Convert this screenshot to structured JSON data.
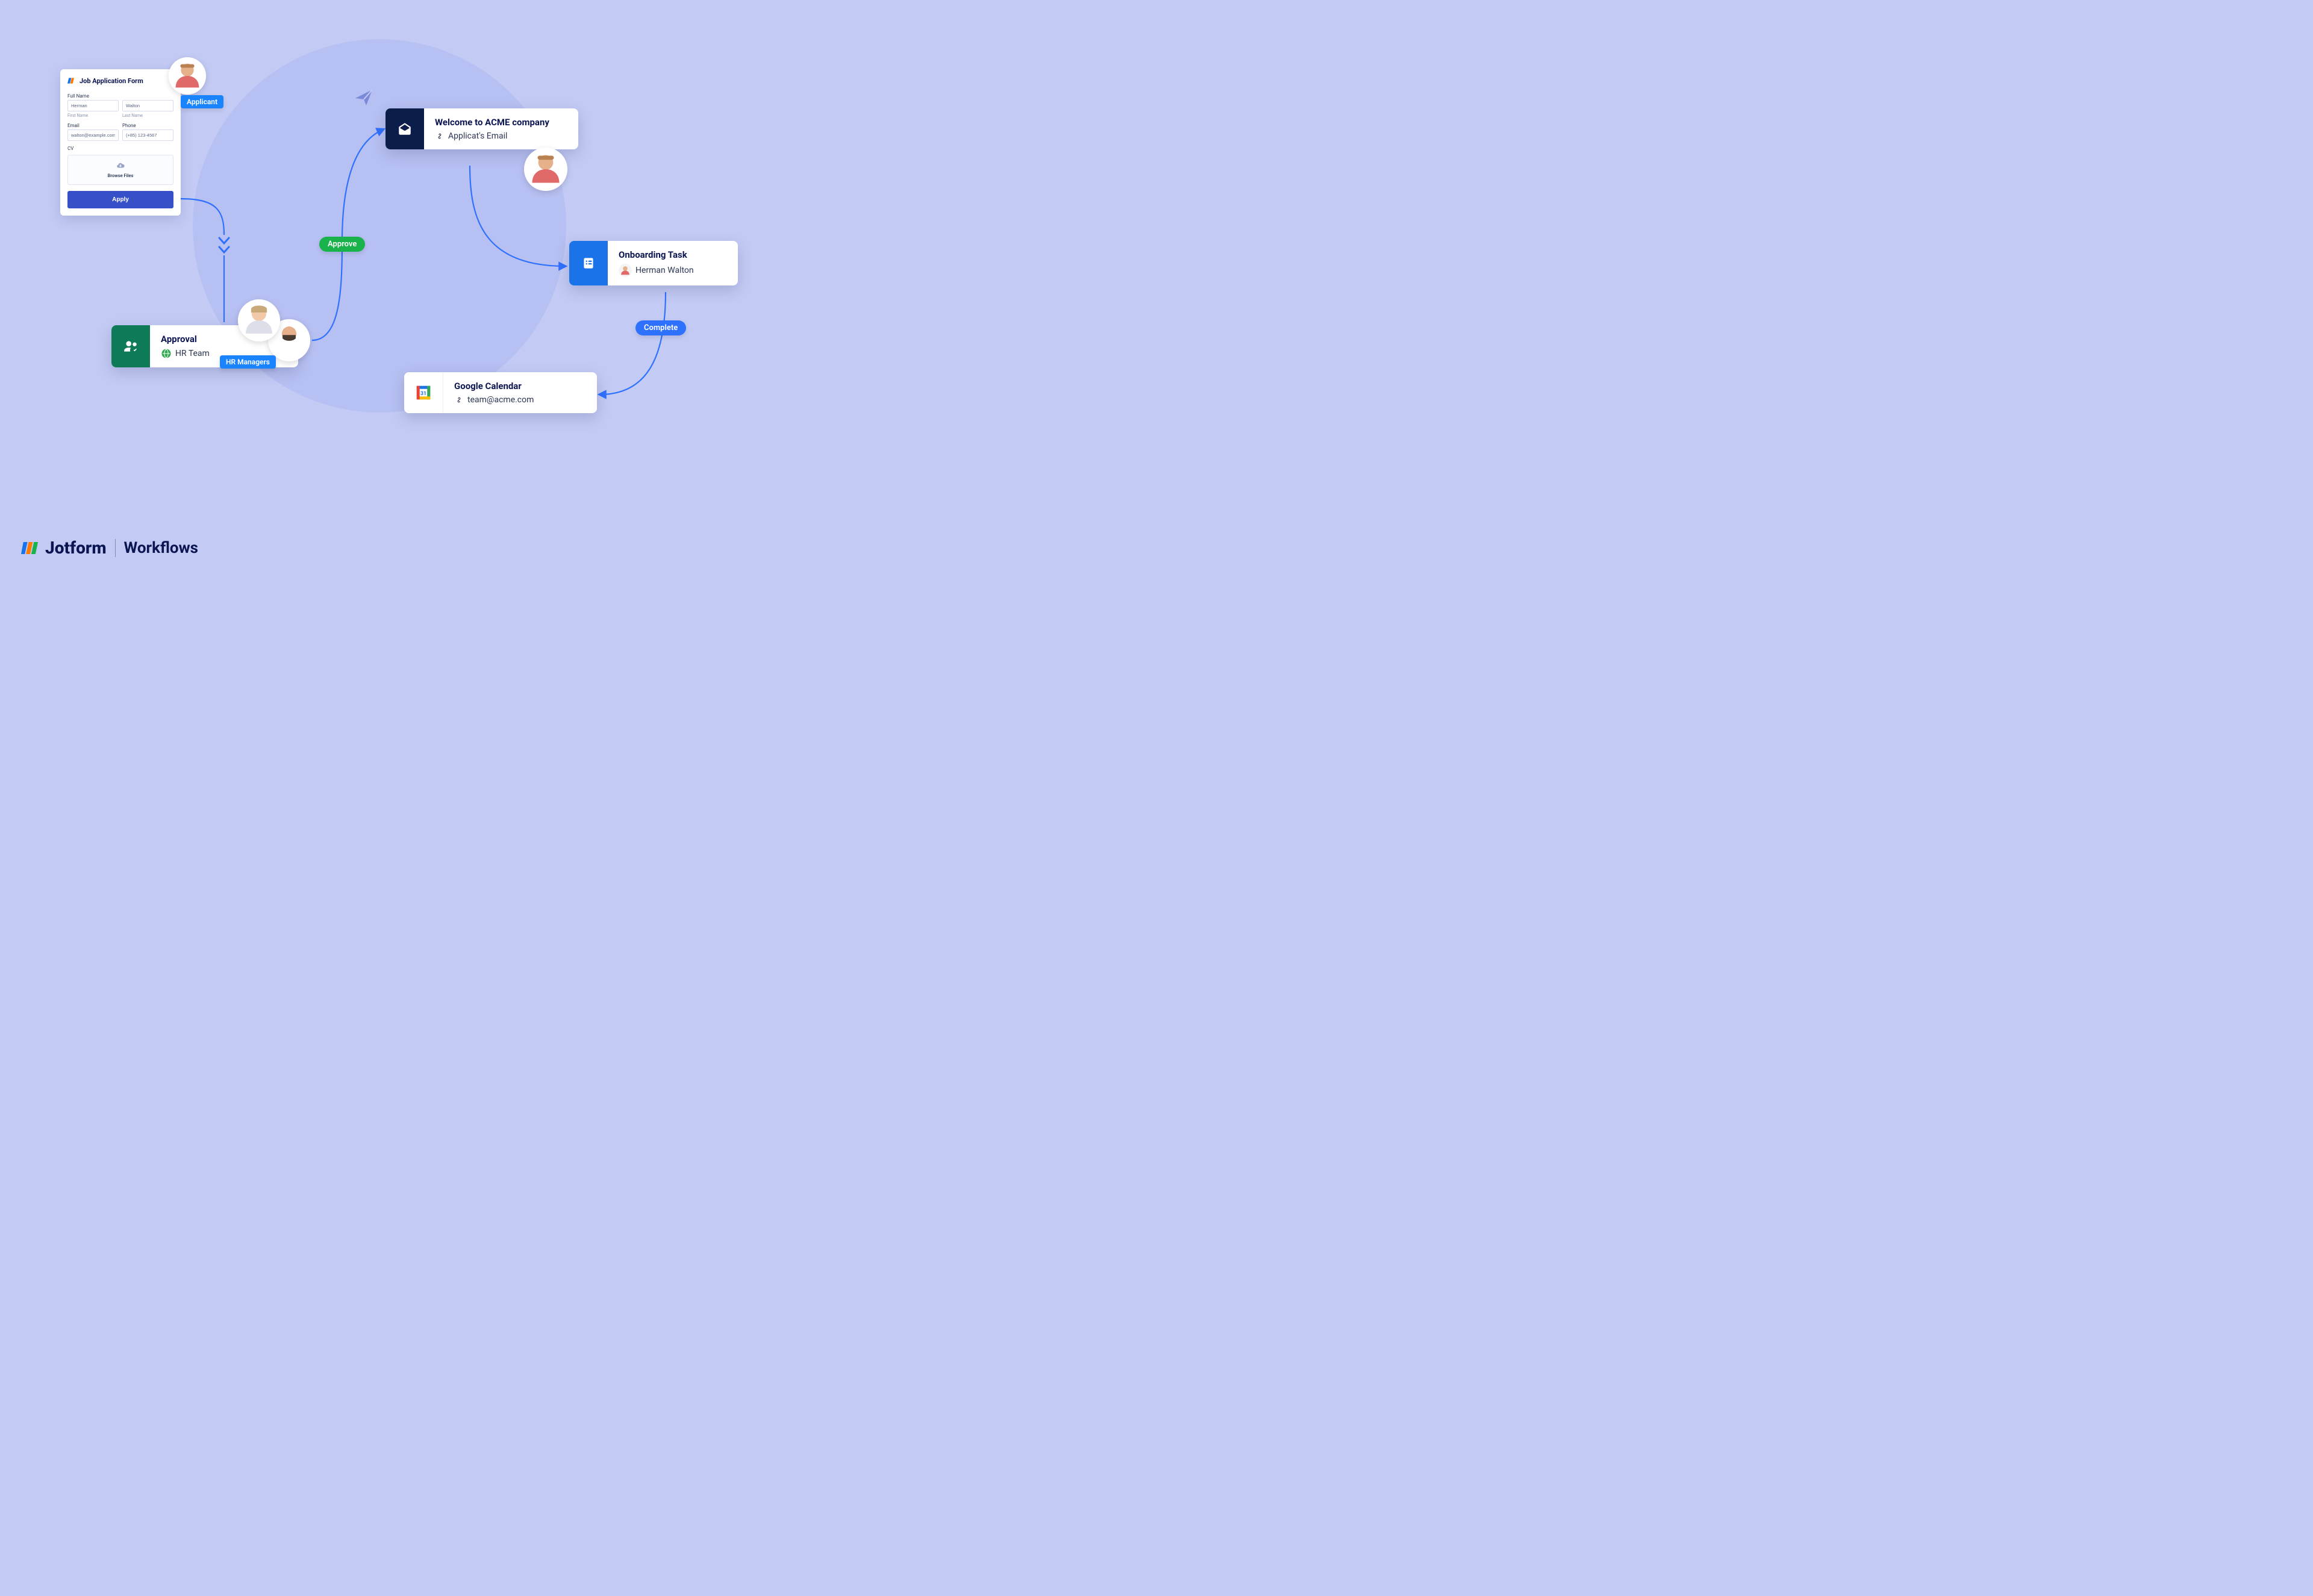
{
  "background_circle_color": "#b7c0f2",
  "form": {
    "title": "Job Application Form",
    "full_name_label": "Full Name",
    "first_name_value": "Herman",
    "last_name_value": "Walton",
    "first_name_sub": "First Name",
    "last_name_sub": "Last Name",
    "email_label": "Email",
    "email_value": "walton@example.com",
    "phone_label": "Phone",
    "phone_value": "(+85) 123-4567",
    "cv_label": "CV",
    "browse_label": "Browse Files",
    "apply_label": "Apply"
  },
  "avatar_labels": {
    "applicant": "Applicant",
    "hr_managers": "HR Managers"
  },
  "approval_card": {
    "title": "Approval",
    "team": "HR Team",
    "icon_bg": "#0f7a57"
  },
  "approve_pill": "Approve",
  "email_card": {
    "title": "Welcome to ACME company",
    "link_text": "Applicat's Email",
    "icon_bg": "#0b1e4a"
  },
  "onboarding_card": {
    "title": "Onboarding Task",
    "person": "Herman Walton",
    "icon_bg": "#1a73e8"
  },
  "complete_pill": "Complete",
  "calendar_card": {
    "title": "Google Calendar",
    "email": "team@acme.com"
  },
  "footer": {
    "brand": "Jotform",
    "product": "Workflows"
  },
  "colors": {
    "pill_green": "#19b24b",
    "pill_blue": "#2f71ff",
    "label_blue": "#1a84ff"
  }
}
